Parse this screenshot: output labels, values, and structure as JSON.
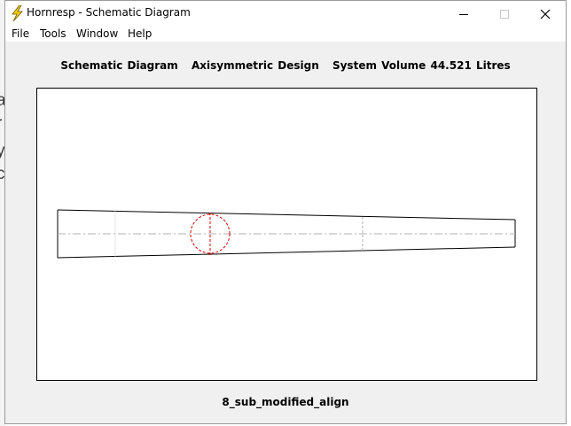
{
  "window": {
    "title": "Hornresp - Schematic Diagram",
    "icon": "lightning-bolt-icon"
  },
  "title_controls": {
    "minimize": "minimize-icon",
    "maximize": "maximize-icon",
    "close": "close-icon"
  },
  "menu": {
    "items": [
      {
        "label": "File"
      },
      {
        "label": "Tools"
      },
      {
        "label": "Window"
      },
      {
        "label": "Help"
      }
    ]
  },
  "header": {
    "diagram_label": "Schematic Diagram",
    "design_label": "Axisymmetric Design",
    "volume_label": "System Volume 44.521 Litres"
  },
  "footer": {
    "record_name": "8_sub_modified_align"
  },
  "colors": {
    "outline": "#000000",
    "driver": "#d40000",
    "centerline": "#b0b0b0"
  }
}
